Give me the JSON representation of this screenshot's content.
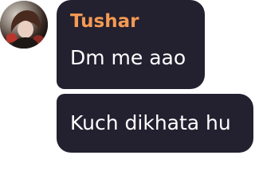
{
  "messages": [
    {
      "sender": "Tushar",
      "text": "Dm me aao"
    },
    {
      "text": "Kuch dikhata hu"
    }
  ],
  "colors": {
    "bubble_bg": "#23202f",
    "sender_name": "#f39a53",
    "message_text": "#ffffff",
    "page_bg": "#ffffff"
  },
  "icons": {
    "avatar": "user-avatar"
  }
}
